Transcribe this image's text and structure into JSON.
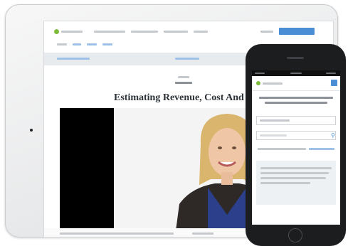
{
  "lesson": {
    "title": "Estimating Revenue, Cost And Profit"
  },
  "colors": {
    "accent": "#4a8fd6",
    "brand": "#7dbb3a"
  },
  "icons": {
    "search": "search-icon",
    "menu": "menu-icon"
  }
}
